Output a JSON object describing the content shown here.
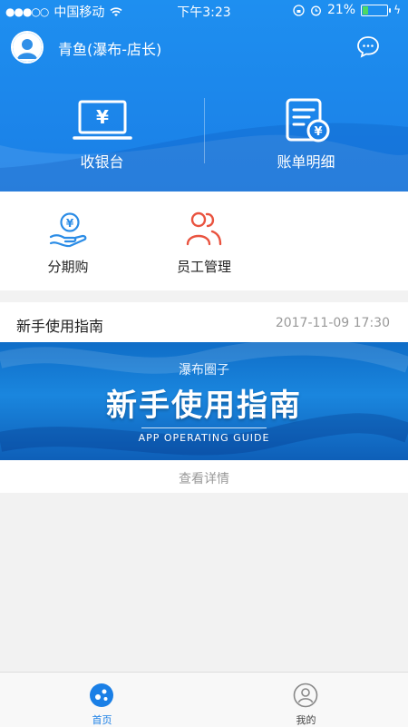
{
  "status": {
    "carrier": "中国移动",
    "time": "下午3:23",
    "battery": "21%",
    "battery_level": 0.21
  },
  "header": {
    "shop_name": "青鱼(瀑布-店长)",
    "icons": [
      "avatar-icon",
      "chat-bubble-icon"
    ]
  },
  "quick_actions": [
    {
      "label": "收银台",
      "icon": "cash-register-icon"
    },
    {
      "label": "账单明细",
      "icon": "bill-detail-icon"
    }
  ],
  "menu": [
    {
      "label": "分期购",
      "icon": "installment-icon",
      "color": "#2b8ce6"
    },
    {
      "label": "员工管理",
      "icon": "staff-icon",
      "color": "#e9533f"
    }
  ],
  "guide": {
    "title": "新手使用指南",
    "date": "2017-11-09 17:30",
    "banner_subtitle": "瀑布圈子",
    "banner_title": "新手使用指南",
    "banner_en": "APP OPERATING GUIDE",
    "more": "查看详情"
  },
  "tabbar": {
    "tabs": [
      {
        "label": "首页",
        "icon": "home-icon",
        "active": true
      },
      {
        "label": "我的",
        "icon": "profile-icon",
        "active": false
      }
    ],
    "active_color": "#1a7fe6"
  }
}
